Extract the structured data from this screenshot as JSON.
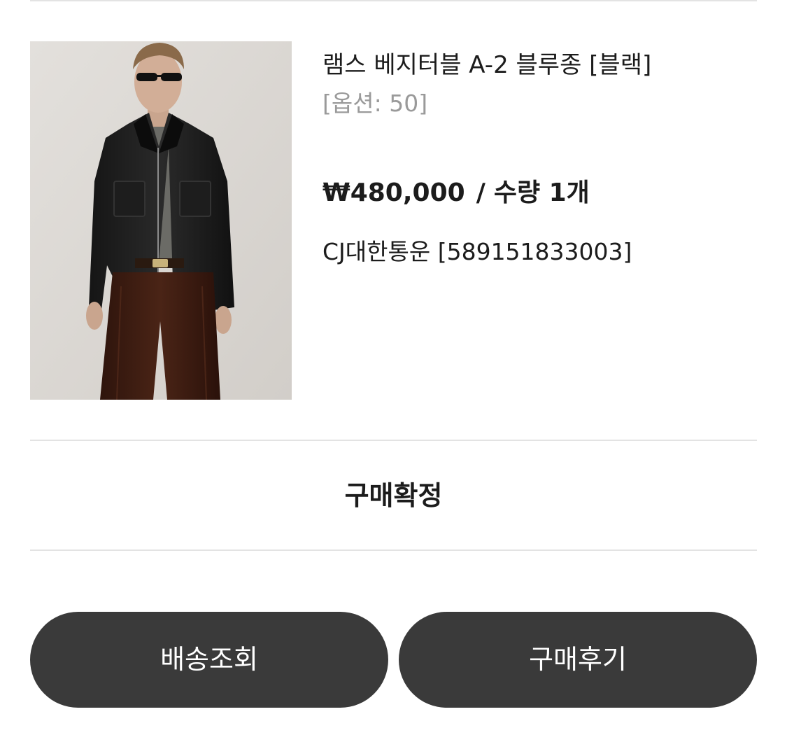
{
  "order": {
    "product_name": "램스 베지터블 A-2 블루종 [블랙]",
    "option": "[옵션: 50]",
    "price": "₩480,000",
    "price_separator": "/",
    "quantity": "수량 1개",
    "carrier_tracking": "CJ대한통운 [589151833003]",
    "status": "구매확정"
  },
  "actions": {
    "track_shipping": "배송조회",
    "write_review": "구매후기"
  },
  "product_image": {
    "subject": "model wearing black leather jacket and brown corduroy pants"
  },
  "colors": {
    "button_bg": "#3a3a3a",
    "divider": "#e3e3e3",
    "option_text": "#9a9a9a"
  }
}
